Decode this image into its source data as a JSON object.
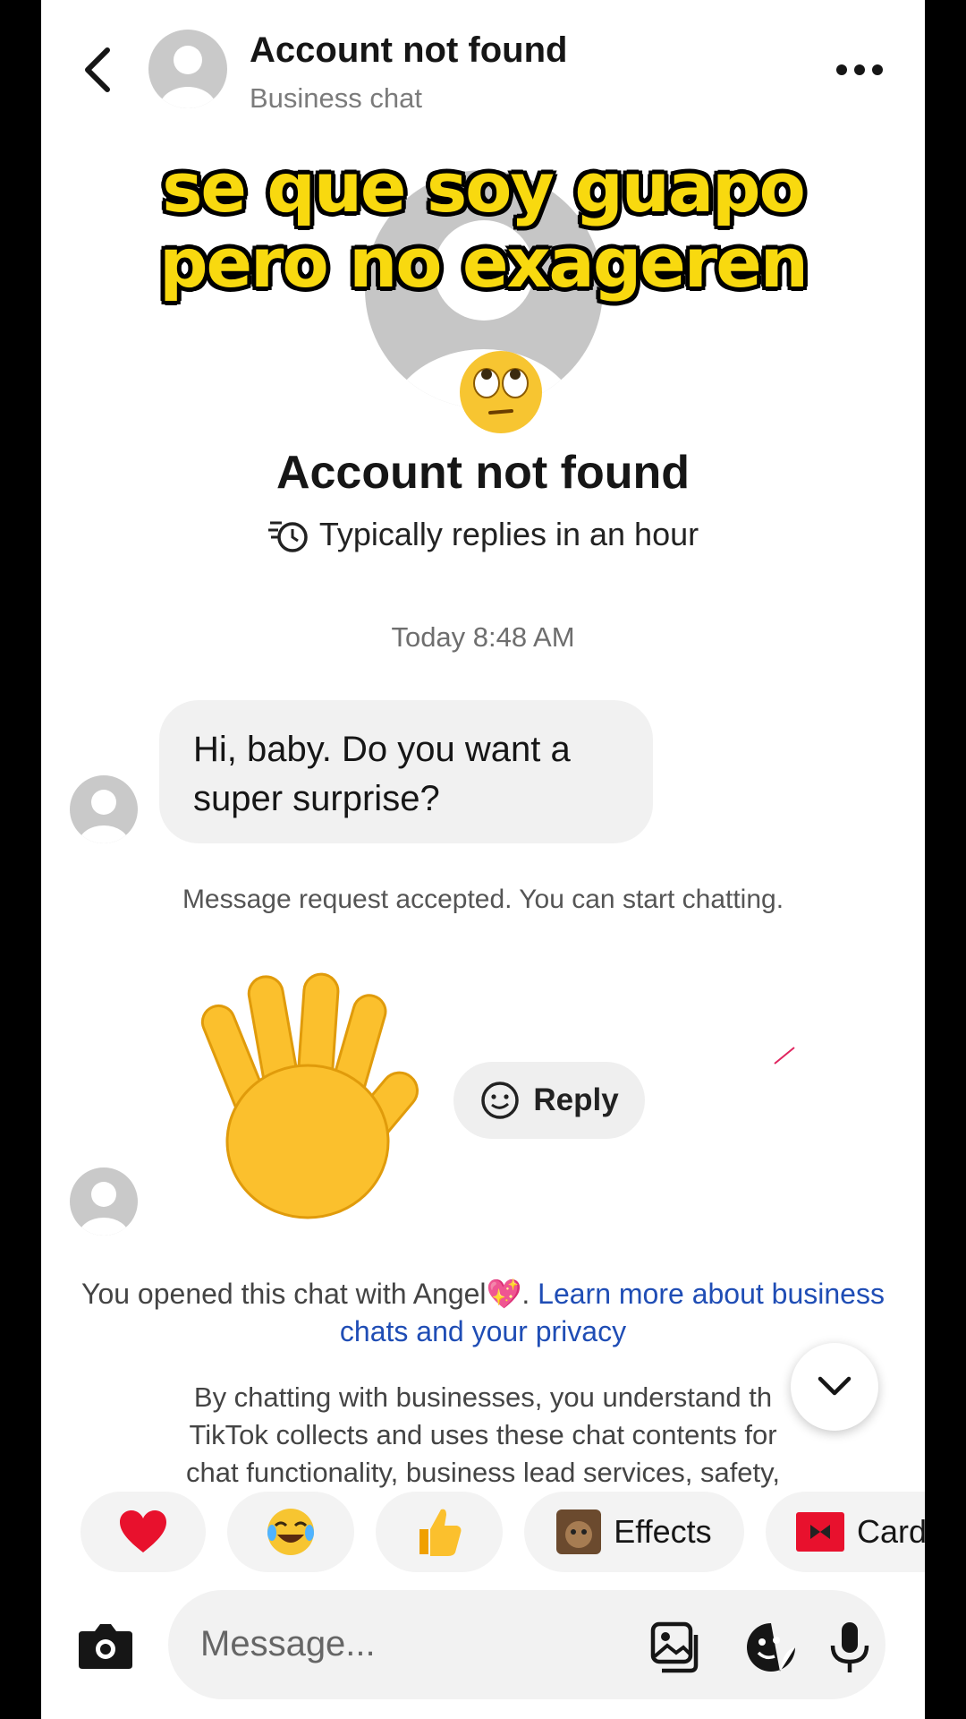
{
  "header": {
    "title": "Account not found",
    "subtitle": "Business chat"
  },
  "overlay_caption": {
    "line1": "se que soy guapo",
    "line2": "pero no exageren"
  },
  "profile": {
    "name": "Account not found",
    "reply_time": "Typically replies in an hour"
  },
  "chat": {
    "timestamp": "Today 8:48 AM",
    "message": "Hi, baby. Do you want a super surprise?",
    "system_notice": "Message request accepted. You can start chatting.",
    "reply_label": "Reply"
  },
  "privacy": {
    "opened_text": "You opened this chat with Angel💖.",
    "link_text": "Learn more about business chats and your privacy",
    "partial_line1": "By chatting with businesses, you understand th",
    "partial_line2": "TikTok collects and uses these chat contents for",
    "partial_line3": "chat functionality, business lead services, safety,"
  },
  "quick_chips": {
    "effects": "Effects",
    "cards": "Card"
  },
  "composer": {
    "placeholder": "Message..."
  },
  "colors": {
    "caption_yellow": "#f8d90f",
    "link_blue": "#1f4db5",
    "bubble_gray": "#f1f1f1"
  },
  "icons": [
    "back-arrow-icon",
    "more-options-icon",
    "stopwatch-icon",
    "smiley-icon",
    "chevron-down-icon",
    "camera-icon",
    "image-icon",
    "sticker-icon",
    "microphone-icon"
  ]
}
